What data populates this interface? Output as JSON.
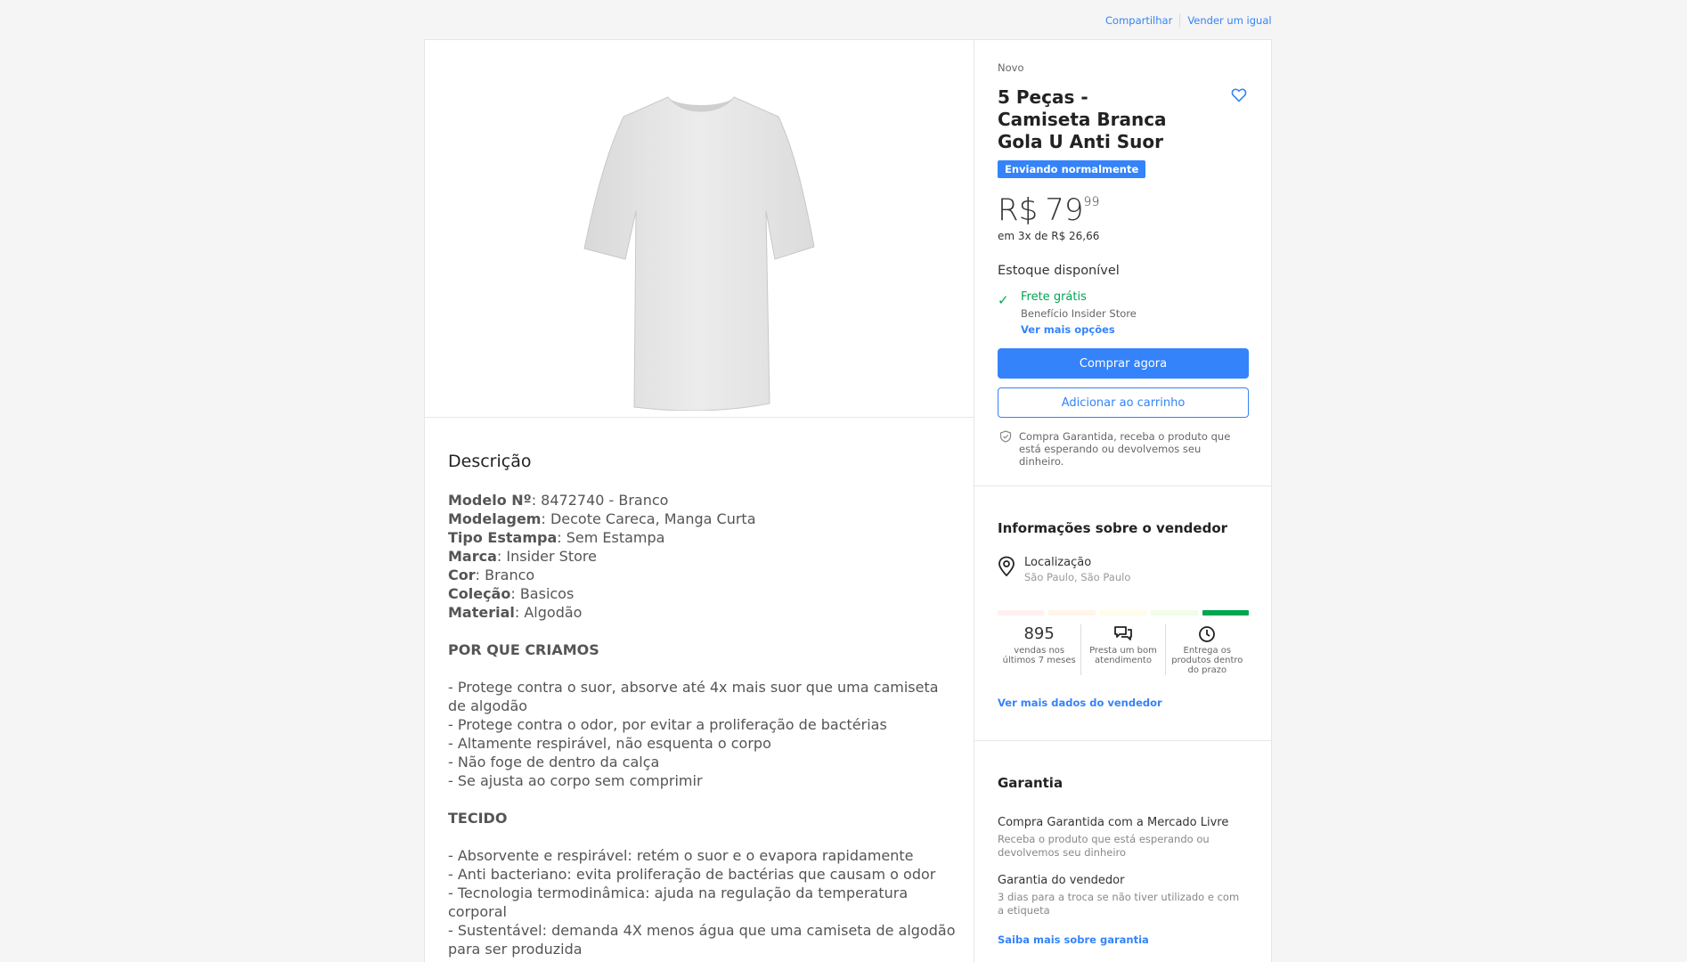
{
  "top_links": {
    "share": "Compartilhar",
    "sell_same": "Vender um igual"
  },
  "product": {
    "condition": "Novo",
    "title": "5 Peças - Camiseta Branca Gola U Anti Suor",
    "badge": "Enviando normalmente",
    "price_currency": "R$",
    "price_integer": "79",
    "price_cents": "99",
    "installments": "em 3x de R$ 26,66",
    "stock": "Estoque disponível",
    "shipping": {
      "free": "Frete grátis",
      "benefit": "Benefício Insider Store",
      "more": "Ver mais opções"
    },
    "buy_now": "Comprar agora",
    "add_to_cart": "Adicionar ao carrinho",
    "guarantee_note": "Compra Garantida, receba o produto que está esperando ou devolvemos seu dinheiro."
  },
  "description": {
    "title": "Descrição",
    "specs": [
      {
        "key": "Modelo Nº",
        "value": ": 8472740 - Branco"
      },
      {
        "key": "Modelagem",
        "value": ": Decote Careca, Manga Curta"
      },
      {
        "key": "Tipo Estampa",
        "value": ": Sem Estampa"
      },
      {
        "key": "Marca",
        "value": ": Insider Store"
      },
      {
        "key": "Cor",
        "value": ": Branco"
      },
      {
        "key": "Coleção",
        "value": ": Basicos"
      },
      {
        "key": "Material",
        "value": ": Algodão"
      }
    ],
    "section1_title": "POR QUE CRIAMOS",
    "section1_items": [
      "- Protege contra o suor, absorve até 4x mais suor que uma camiseta de algodão",
      "- Protege contra o odor, por evitar a proliferação de bactérias",
      "- Altamente respirável, não esquenta o corpo",
      "- Não foge de dentro da calça",
      "- Se ajusta ao corpo sem comprimir"
    ],
    "section2_title": "TECIDO",
    "section2_items": [
      "- Absorvente e respirável: retém o suor e o evapora rapidamente",
      "- Anti bacteriano: evita proliferação de bactérias que causam o odor",
      "- Tecnologia termodinâmica: ajuda na regulação da temperatura corporal",
      "- Sustentável: demanda 4X menos água que uma camiseta de algodão para ser produzida"
    ]
  },
  "seller": {
    "title": "Informações sobre o vendedor",
    "location_label": "Localização",
    "location_value": "São Paulo, São Paulo",
    "thermometer_colors": [
      "#fff0f0",
      "#fff5e8",
      "#fffce8",
      "#f1fde7",
      "#00a650"
    ],
    "sales_count": "895",
    "sales_label": "vendas nos últimos 7 meses",
    "service_label": "Presta um bom atendimento",
    "delivery_label": "Entrega os produtos dentro do prazo",
    "more_link": "Ver mais dados do vendedor"
  },
  "warranty": {
    "title": "Garantia",
    "item1_title": "Compra Garantida com a Mercado Livre",
    "item1_desc": "Receba o produto que está esperando ou devolvemos seu dinheiro",
    "item2_title": "Garantia do vendedor",
    "item2_desc": "3 dias para a troca se não tiver utilizado e com a etiqueta",
    "link": "Saiba mais sobre garantia"
  },
  "colors": {
    "accent": "#3483fa",
    "success": "#00a650"
  }
}
